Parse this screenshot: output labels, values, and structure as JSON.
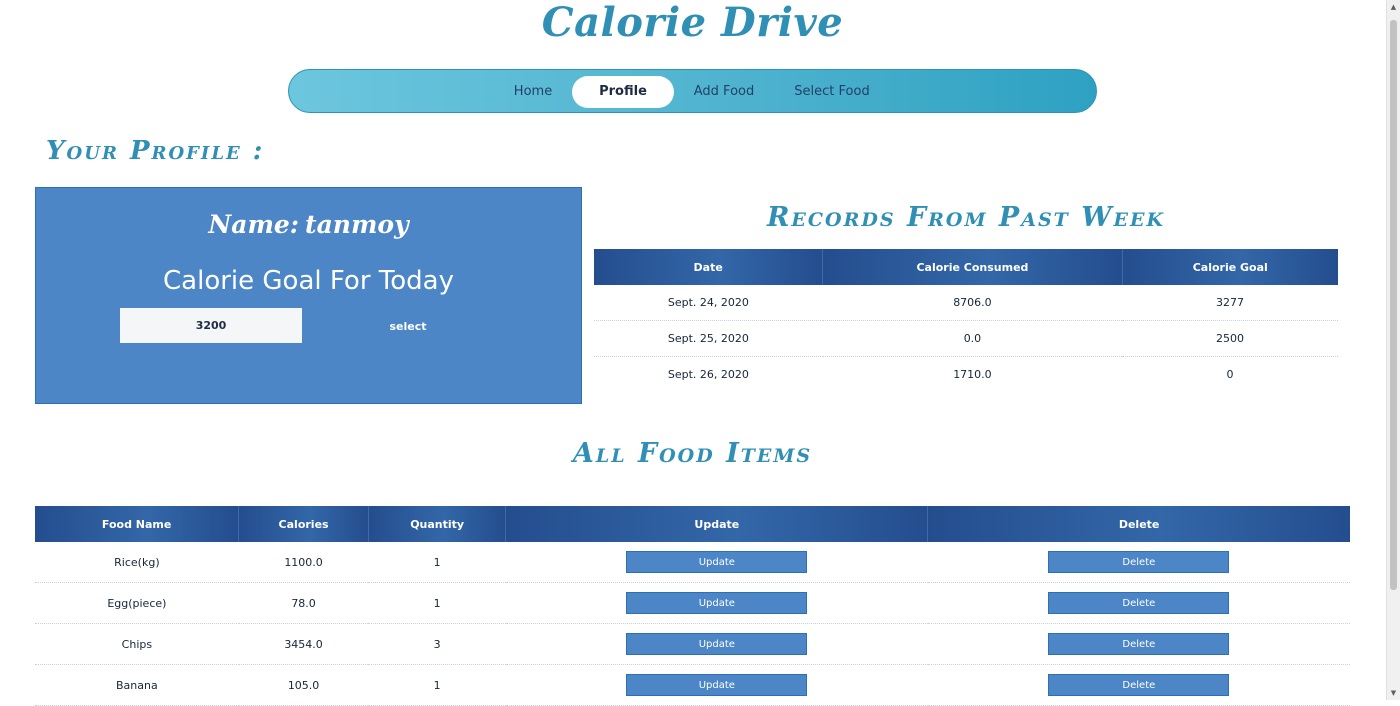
{
  "app": {
    "title": "Calorie Drive"
  },
  "nav": {
    "items": [
      {
        "label": "Home",
        "active": false
      },
      {
        "label": "Profile",
        "active": true
      },
      {
        "label": "Add Food",
        "active": false
      },
      {
        "label": "Select Food",
        "active": false
      }
    ]
  },
  "profile_section": {
    "heading": "Your Profile :"
  },
  "profile": {
    "name_label": "Name:",
    "name_value": "tanmoy",
    "goal_title": "Calorie Goal For Today",
    "goal_value": "3200",
    "select_label": "select"
  },
  "records": {
    "heading": "Records From Past Week",
    "columns": [
      "Date",
      "Calorie Consumed",
      "Calorie Goal"
    ],
    "rows": [
      [
        "Sept. 24, 2020",
        "8706.0",
        "3277"
      ],
      [
        "Sept. 25, 2020",
        "0.0",
        "2500"
      ],
      [
        "Sept. 26, 2020",
        "1710.0",
        "0"
      ]
    ]
  },
  "foods": {
    "heading": "All Food Items",
    "columns": [
      "Food Name",
      "Calories",
      "Quantity",
      "Update",
      "Delete"
    ],
    "update_label": "Update",
    "delete_label": "Delete",
    "rows": [
      [
        "Rice(kg)",
        "1100.0",
        "1"
      ],
      [
        "Egg(piece)",
        "78.0",
        "1"
      ],
      [
        "Chips",
        "3454.0",
        "3"
      ],
      [
        "Banana",
        "105.0",
        "1"
      ]
    ]
  },
  "colors": {
    "brand": "#2f8fb4",
    "card": "#4c86c7",
    "table_header": "#244d8e",
    "nav_gradient_start": "#6cc6de",
    "nav_gradient_end": "#2ea1c2"
  }
}
